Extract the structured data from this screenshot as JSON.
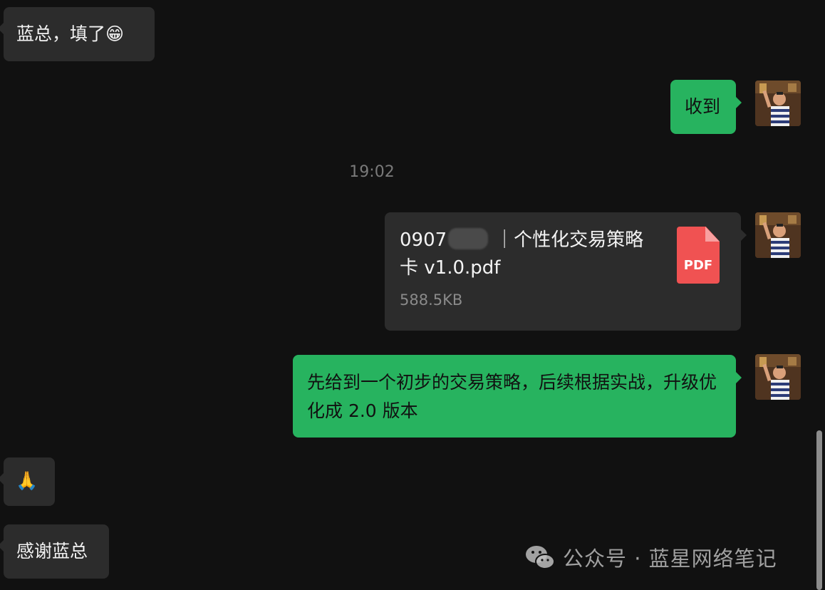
{
  "chat": {
    "messages": [
      {
        "sender": "contact",
        "text": "蓝总，填了😁"
      },
      {
        "sender": "me",
        "text": "收到"
      },
      {
        "type": "timestamp",
        "text": "19:02"
      },
      {
        "sender": "me",
        "type": "file",
        "file_name_part1": "0907",
        "file_name_part2": "｜个性化交易策略",
        "file_name_part3": "卡 v1.0.pdf",
        "file_size": "588.5KB",
        "file_type_label": "PDF",
        "file_icon_color": "#f05252"
      },
      {
        "sender": "me",
        "text": "先给到一个初步的交易策略，后续根据实战，升级优化成 2.0 版本"
      },
      {
        "sender": "contact",
        "text": "🙏"
      },
      {
        "sender": "contact",
        "text": "感谢蓝总"
      }
    ]
  },
  "watermark": {
    "text": "公众号 · 蓝星网络笔记",
    "icon": "wechat-icon"
  },
  "colors": {
    "background": "#111111",
    "incoming_bubble": "#2c2c2c",
    "outgoing_bubble": "#27b35f",
    "timestamp": "#7a7a7a"
  }
}
